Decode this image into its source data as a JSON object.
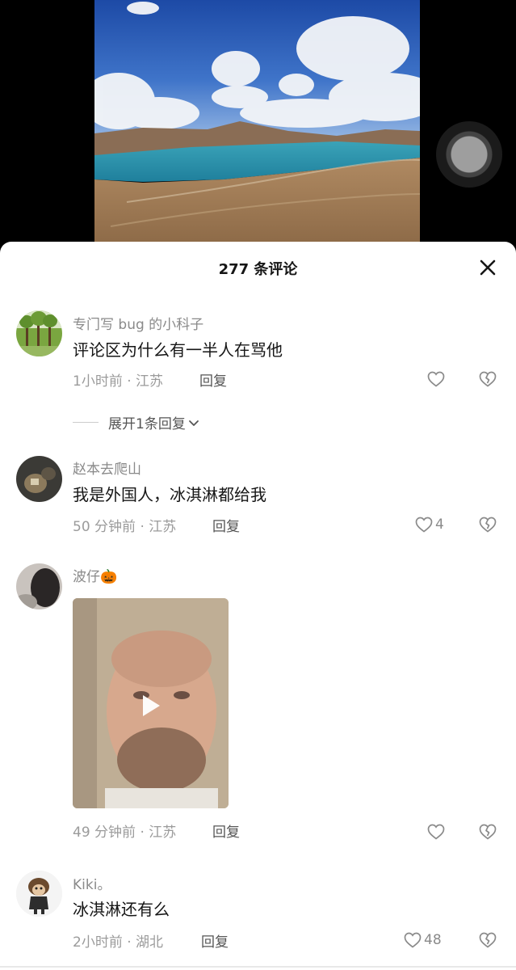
{
  "sheet": {
    "title": "277 条评论"
  },
  "comments": [
    {
      "user": "专门写 bug 的小科子",
      "text": "评论区为什么有一半人在骂他",
      "meta": "1小时前 · 江苏",
      "reply_label": "回复",
      "like_count": "",
      "expand_label": "展开1条回复"
    },
    {
      "user": "赵本去爬山",
      "text": "我是外国人，冰淇淋都给我",
      "meta": "50 分钟前 · 江苏",
      "reply_label": "回复",
      "like_count": "4"
    },
    {
      "user": "波仔🎃",
      "text": "",
      "meta": "49 分钟前 · 江苏",
      "reply_label": "回复",
      "like_count": ""
    },
    {
      "user": "Kiki。",
      "text": "冰淇淋还有么",
      "meta": "2小时前 · 湖北",
      "reply_label": "回复",
      "like_count": "48"
    }
  ],
  "icons": {
    "close": "close-icon",
    "like": "heart-icon",
    "dislike": "broken-heart-icon",
    "play": "play-icon",
    "expand_chevron": "chevron-down-icon"
  }
}
